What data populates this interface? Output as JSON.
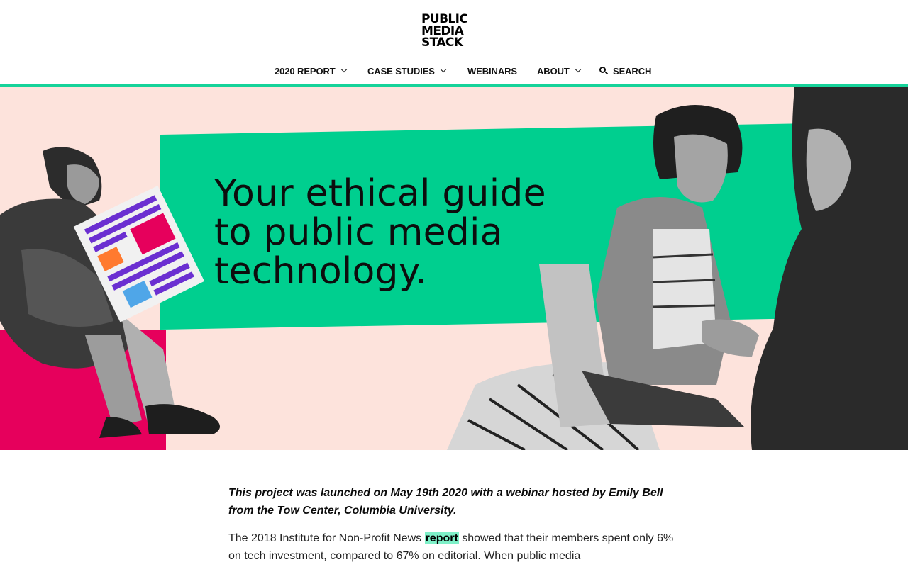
{
  "logo": {
    "lines": [
      "PUBLIC",
      "MEDIA",
      "STACK"
    ]
  },
  "nav": {
    "items": [
      {
        "label": "2020 REPORT",
        "dropdown": true
      },
      {
        "label": "CASE STUDIES",
        "dropdown": true
      },
      {
        "label": "WEBINARS",
        "dropdown": false
      },
      {
        "label": "ABOUT",
        "dropdown": true
      }
    ],
    "search_label": "SEARCH"
  },
  "hero": {
    "title_lines": [
      "Your ethical guide",
      "to public media",
      "technology."
    ]
  },
  "content": {
    "intro": "This project was launched on May 19th 2020 with a webinar hosted by Emily Bell from the Tow Center, Columbia University.",
    "para_before": "The 2018 Institute for Non-Profit News ",
    "para_link": "report",
    "para_after": " showed that their members spent only 6% on tech investment, compared to 67% on editorial. When public media"
  },
  "colors": {
    "accent_green": "#16d39a",
    "hero_bg": "#fde3dc",
    "hero_green": "#00cf8f",
    "hero_pink": "#e6005c",
    "link_highlight": "#7ef0c8"
  }
}
